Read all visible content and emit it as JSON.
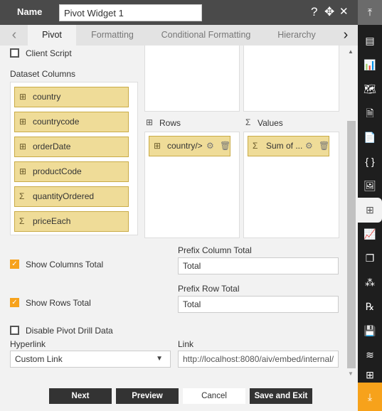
{
  "header": {
    "name_label": "Name",
    "name_value": "Pivot Widget 1",
    "help_icon": "?",
    "move_icon": "✥",
    "close_icon": "✕"
  },
  "tabs": [
    {
      "label": "Pivot",
      "active": true
    },
    {
      "label": "Formatting"
    },
    {
      "label": "Conditional Formatting"
    },
    {
      "label": "Hierarchy"
    }
  ],
  "client_script": {
    "label": "Client Script",
    "checked": false
  },
  "dataset_columns": {
    "title": "Dataset Columns",
    "items": [
      {
        "label": "country",
        "icon": "table-icon"
      },
      {
        "label": "countrycode",
        "icon": "table-icon"
      },
      {
        "label": "orderDate",
        "icon": "table-icon"
      },
      {
        "label": "productCode",
        "icon": "table-icon"
      },
      {
        "label": "quantityOrdered",
        "icon": "sigma-icon"
      },
      {
        "label": "priceEach",
        "icon": "sigma-icon"
      }
    ]
  },
  "rows": {
    "title": "Rows",
    "items": [
      {
        "label": "country/>"
      }
    ]
  },
  "values": {
    "title": "Values",
    "items": [
      {
        "label": "Sum of ..."
      }
    ]
  },
  "show_columns_total": {
    "label": "Show Columns Total",
    "checked": true
  },
  "prefix_column_total": {
    "label": "Prefix Column Total",
    "value": "Total"
  },
  "show_rows_total": {
    "label": "Show Rows Total",
    "checked": true
  },
  "prefix_row_total": {
    "label": "Prefix Row Total",
    "value": "Total"
  },
  "disable_drill": {
    "label": "Disable Pivot Drill Data",
    "checked": false
  },
  "hyperlink": {
    "label": "Hyperlink",
    "value": "Custom Link"
  },
  "link": {
    "label": "Link",
    "value": "http://localhost:8080/aiv/embed/internal/"
  },
  "buttons": {
    "next": "Next",
    "preview": "Preview",
    "cancel": "Cancel",
    "save": "Save and Exit"
  },
  "colors": {
    "accent": "#f7a21b",
    "header": "#4a4a4a",
    "field_fill": "#efdc98",
    "sidebar": "#1e1e1e"
  }
}
